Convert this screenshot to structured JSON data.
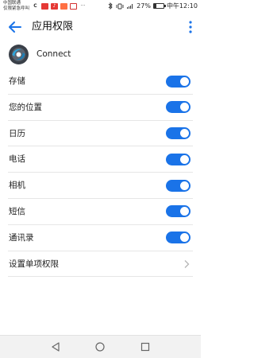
{
  "status_bar": {
    "carrier_line1": "中国联通",
    "carrier_line2": "仅限紧急呼叫",
    "battery_percent": "27%",
    "battery_level": 0.27,
    "time": "中午12:10",
    "notification_icons": [
      "c-icon",
      "message-icon",
      "music-icon",
      "red-app-icon",
      "more-dots"
    ]
  },
  "app_bar": {
    "title": "应用权限"
  },
  "app": {
    "name": "Connect",
    "icon": "connect-logo-icon"
  },
  "permissions": [
    {
      "label": "存储",
      "enabled": true
    },
    {
      "label": "您的位置",
      "enabled": true
    },
    {
      "label": "日历",
      "enabled": true
    },
    {
      "label": "电话",
      "enabled": true
    },
    {
      "label": "相机",
      "enabled": true
    },
    {
      "label": "短信",
      "enabled": true
    },
    {
      "label": "通讯录",
      "enabled": true
    }
  ],
  "individual_permissions": {
    "label": "设置单项权限"
  },
  "colors": {
    "accent": "#1a73e8",
    "toggle_knob": "#ffffff",
    "divider": "#e6e6e6",
    "nav_background": "#f2f2f2"
  }
}
